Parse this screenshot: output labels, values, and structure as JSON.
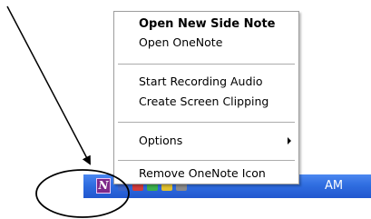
{
  "menu": {
    "items": [
      {
        "label": "Open New Side Note",
        "bold": true
      },
      {
        "label": "Open OneNote"
      },
      {
        "label": "Start Recording Audio"
      },
      {
        "label": "Create Screen Clipping"
      },
      {
        "label": "Options",
        "submenu": true
      },
      {
        "label": "Remove OneNote Icon"
      }
    ]
  },
  "taskbar": {
    "clock_text": "AM",
    "colors": {
      "taskbar": "#2f6de0",
      "onenote_icon": "#7e2a8a"
    },
    "tray_icons": [
      "onenote-icon",
      "speaker-icon",
      "network-icon",
      "security-icon",
      "app-icon",
      "app-icon"
    ]
  },
  "annotation": {
    "color": "#000000",
    "shapes": [
      "arrow",
      "ellipse"
    ]
  }
}
